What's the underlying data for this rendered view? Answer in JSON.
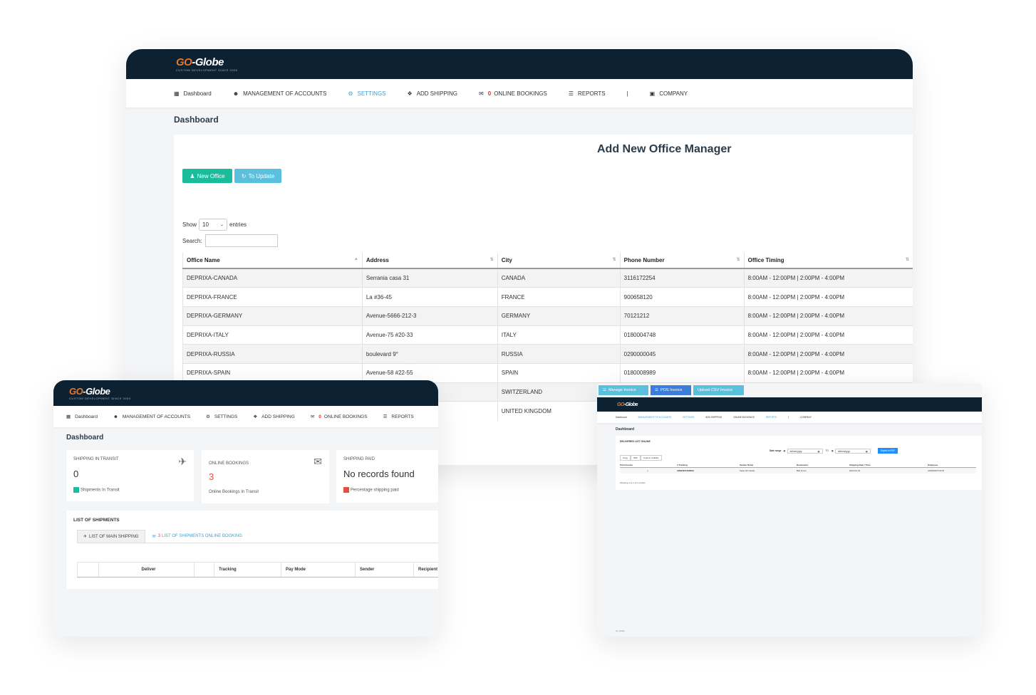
{
  "main": {
    "logo": {
      "go": "GO",
      "rest": "-Globe",
      "tagline": "CUSTOM DEVELOPMENT SINCE 2005"
    },
    "nav": [
      {
        "label": "Dashboard",
        "icon": "dashboard-icon"
      },
      {
        "label": "MANAGEMENT OF ACCOUNTS",
        "icon": "users-icon"
      },
      {
        "label": "SETTINGS",
        "icon": "gear-icon",
        "active": true
      },
      {
        "label": "ADD SHIPPING",
        "icon": "cubes-icon"
      },
      {
        "label": "ONLINE BOOKINGS",
        "icon": "envelope-icon",
        "badge": "0"
      },
      {
        "label": "REPORTS",
        "icon": "list-icon"
      },
      {
        "label": "|",
        "icon": ""
      },
      {
        "label": "COMPANY",
        "icon": "briefcase-icon"
      }
    ],
    "page_title": "Dashboard",
    "card_title": "Add New Office Manager",
    "buttons": {
      "new_office": "New Office",
      "to_update": "To Update"
    },
    "show_label": "Show",
    "entries_value": "10",
    "entries_label": "entries",
    "search_label": "Search:",
    "table": {
      "headers": [
        "Office Name",
        "Address",
        "City",
        "Phone Number",
        "Office Timing"
      ],
      "rows": [
        [
          "DEPRIXA-CANADA",
          "Serrania casa 31",
          "CANADA",
          "3116172254",
          "8:00AM - 12:00PM | 2:00PM - 4:00PM"
        ],
        [
          "DEPRIXA-FRANCE",
          "La #36-45",
          "FRANCE",
          "900658120",
          "8:00AM - 12:00PM | 2:00PM - 4:00PM"
        ],
        [
          "DEPRIXA-GERMANY",
          "Avenue-5666-212-3",
          "GERMANY",
          "70121212",
          "8:00AM - 12:00PM | 2:00PM - 4:00PM"
        ],
        [
          "DEPRIXA-ITALY",
          "Avenue-75 #20-33",
          "ITALY",
          "0180004748",
          "8:00AM - 12:00PM | 2:00PM - 4:00PM"
        ],
        [
          "DEPRIXA-RUSSIA",
          "boulevard 9°",
          "RUSSIA",
          "0290000045",
          "8:00AM - 12:00PM | 2:00PM - 4:00PM"
        ],
        [
          "DEPRIXA-SPAIN",
          "Avenue-58 #22-55",
          "SPAIN",
          "0180008989",
          "8:00AM - 12:00PM | 2:00PM - 4:00PM"
        ],
        [
          "",
          "",
          "SWITZERLAND",
          "",
          ""
        ],
        [
          "",
          "",
          "UNITED KINGDOM",
          "",
          ""
        ]
      ]
    }
  },
  "left": {
    "logo": {
      "go": "GO",
      "rest": "-Globe",
      "tagline": "CUSTOM DEVELOPMENT SINCE 2005"
    },
    "nav": [
      {
        "label": "Dashboard",
        "icon": "dashboard-icon"
      },
      {
        "label": "MANAGEMENT OF ACCOUNTS",
        "icon": "users-icon"
      },
      {
        "label": "SETTINGS",
        "icon": "gear-icon"
      },
      {
        "label": "ADD SHIPPING",
        "icon": "cubes-icon"
      },
      {
        "label": "ONLINE BOOKINGS",
        "icon": "envelope-icon",
        "badge": "0"
      },
      {
        "label": "REPORTS",
        "icon": "list-icon"
      }
    ],
    "page_title": "Dashboard",
    "stats": [
      {
        "title": "SHIPPING IN TRANSIT",
        "value": "0",
        "foot": "Shipments In Transit",
        "color": "#1abc9c",
        "icon": "plane-icon"
      },
      {
        "title": "ONLINE BOOKINGS",
        "value": "3",
        "foot": "Online Bookings In Transit",
        "color": "#e74c3c",
        "icon": "envelope-open-icon"
      },
      {
        "title": "SHIPPING PAID",
        "value": "No records found",
        "foot": "Percentage shipping paid",
        "color": "#e74c3c",
        "icon": ""
      }
    ],
    "list_title": "LIST OF SHIPMENTS",
    "tabs": [
      {
        "label": "LIST OF MAIN SHIPPING"
      },
      {
        "label": "LIST OF SHIPMENTS ONLINE BOOKING",
        "count": "3"
      }
    ],
    "table_headers": [
      "",
      "Deliver",
      "",
      "Tracking",
      "Pay Mode",
      "Sender",
      "Recipient"
    ]
  },
  "right": {
    "top_buttons": [
      "Manage Invoice",
      "POS Invoice",
      "Upload CSV Invoice"
    ],
    "logo": {
      "go": "GO",
      "rest": "-Globe"
    },
    "nav": [
      "Dashboard",
      "MANAGEMENT OF ACCOUNTS",
      "SETTINGS",
      "ADD SHIPPING",
      "ONLINE BOOKINGS",
      "REPORTS",
      "|",
      "COMPANY"
    ],
    "page_title": "Dashboard",
    "card_title": "DELIVERED LIST ONLINE",
    "date_range_label": "Date range",
    "date_placeholder": "dd/mm/yyyy",
    "to_label": "TO",
    "export_label": "Export to PDF",
    "tool_buttons": [
      "Copy",
      "PDF",
      "Column visibility"
    ],
    "headers": [
      "Print Invoice",
      "# Tracking",
      "Sender Name",
      "Destination",
      "Shipping Date / Time",
      "Employee"
    ],
    "row": [
      "",
      "AWB4021468509",
      "Karel GO Globe",
      "Bial Imran",
      "2024-01-01",
      "ASHMHS7741T0"
    ],
    "info": "Showing 1 to 1 of 1 entries",
    "footer": "Go Globe"
  }
}
